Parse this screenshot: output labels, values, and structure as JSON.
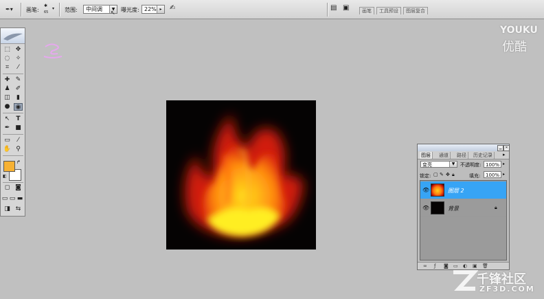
{
  "options_bar": {
    "brush_label": "画笔:",
    "brush_size": "65",
    "range_label": "范围:",
    "range_value": "中间调",
    "exposure_label": "曝光度:",
    "exposure_value": "22%",
    "wells": [
      "画笔",
      "工具预设",
      "图层复合"
    ]
  },
  "layers_panel": {
    "tabs": [
      "图层",
      "通道",
      "路径",
      "历史记录"
    ],
    "blend_mode": "变亮",
    "opacity_label": "不透明度:",
    "opacity_value": "100%",
    "lock_label": "锁定:",
    "fill_label": "填充:",
    "fill_value": "100%",
    "layers": [
      {
        "name": "图层 2",
        "selected": true
      },
      {
        "name": "背景",
        "selected": false
      }
    ]
  },
  "colors": {
    "foreground": "#f6b133",
    "background": "#ffffff",
    "selected_layer": "#37a4f5"
  },
  "watermarks": {
    "youku_en": "YOUKU",
    "youku_cn": "优酷",
    "site_cn": "千锋社区",
    "site_en": "ZF3D.COM"
  }
}
